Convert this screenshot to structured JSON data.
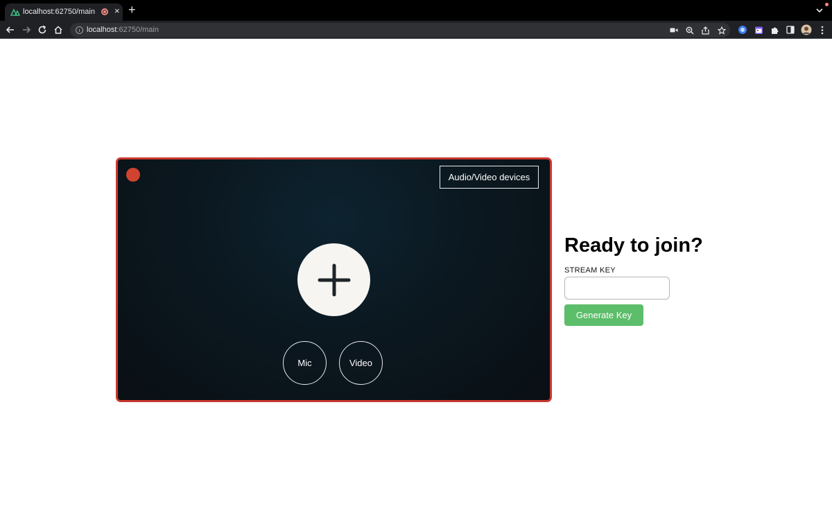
{
  "browser": {
    "tab_title": "localhost:62750/main",
    "tab_close": "×",
    "new_tab": "+",
    "url_host": "localhost",
    "url_rest": ":62750/main",
    "icons": [
      "back-icon",
      "forward-icon",
      "reload-icon",
      "home-icon",
      "site-info-icon",
      "camera-in-use-icon",
      "zoom-icon",
      "share-icon",
      "bookmark-star-icon",
      "extension-icon",
      "side-panel-icon",
      "profile-avatar"
    ]
  },
  "stage": {
    "devices_label": "Audio/Video devices",
    "mic_label": "Mic",
    "video_label": "Video",
    "border_color": "#c9392f",
    "rec_color": "#d0432f"
  },
  "join": {
    "title": "Ready to join?",
    "key_label": "STREAM KEY",
    "key_value": "",
    "generate_label": "Generate Key",
    "button_color": "#5cbd6a"
  }
}
